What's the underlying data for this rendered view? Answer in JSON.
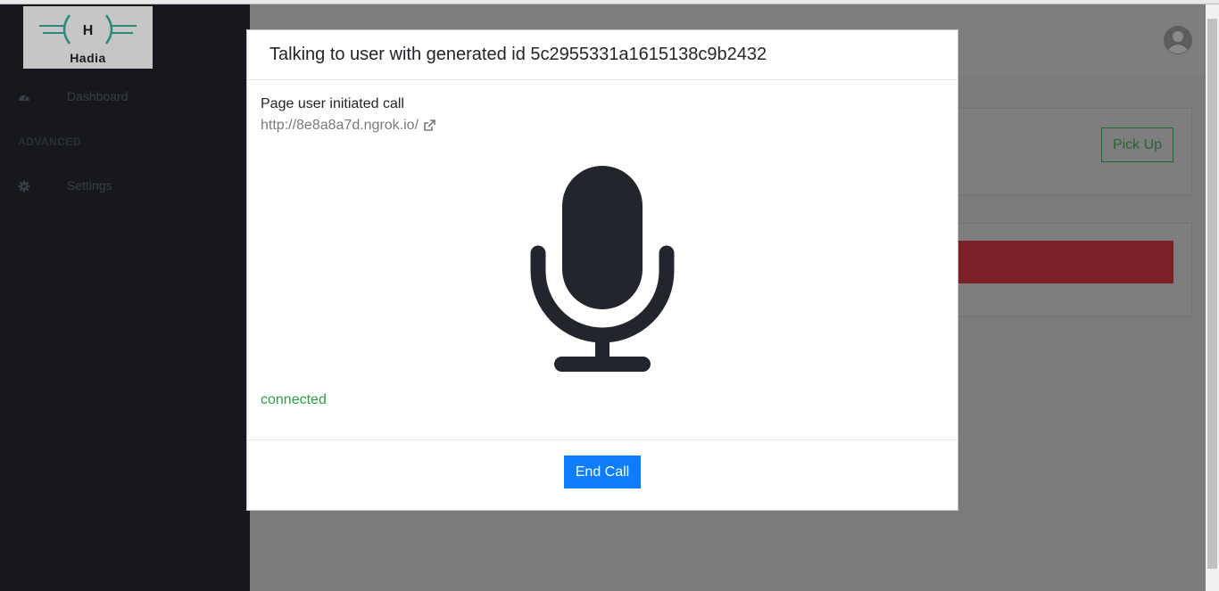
{
  "app": {
    "brand": "Hadia"
  },
  "sidebar": {
    "items": [
      {
        "label": "Dashboard",
        "icon": "dashboard-icon"
      },
      {
        "label": "Settings",
        "icon": "gear-icon"
      }
    ],
    "section_label": "ADVANCED"
  },
  "main": {
    "pickup_label": "Pick Up",
    "user_icon": "user-avatar-icon"
  },
  "modal": {
    "title": "Talking to user with generated id 5c2955331a1615138c9b2432",
    "origin_label": "Page user initiated call",
    "origin_url": "http://8e8a8a7d.ngrok.io/",
    "status": "connected",
    "end_call_label": "End Call",
    "mic_icon": "microphone-icon"
  },
  "colors": {
    "sidebar_bg": "#16181d",
    "backdrop": "#7b7b7d",
    "primary_button": "#0d7dfb",
    "status_connected": "#2e9e44",
    "pickup_green": "#1f6b2c",
    "alert_red": "#7a2128"
  }
}
